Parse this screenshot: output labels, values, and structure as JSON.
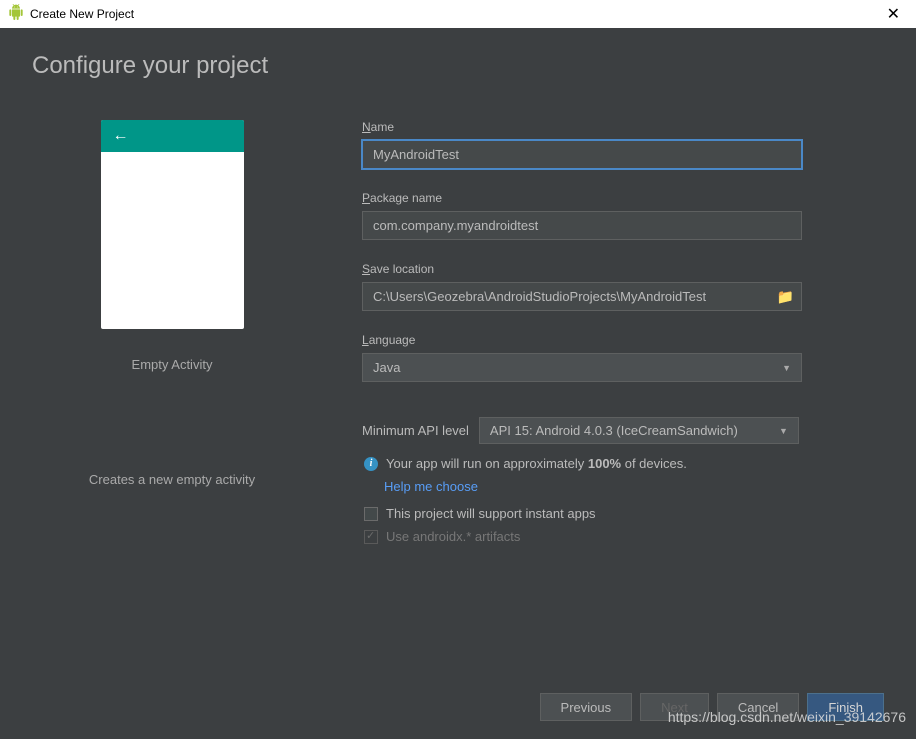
{
  "titlebar": {
    "title": "Create New Project"
  },
  "page": {
    "title": "Configure your project"
  },
  "preview": {
    "title": "Empty Activity",
    "description": "Creates a new empty activity"
  },
  "form": {
    "name_label": "Name",
    "name_value": "MyAndroidTest",
    "package_label": "Package name",
    "package_value": "com.company.myandroidtest",
    "save_label": "Save location",
    "save_value": "C:\\Users\\Geozebra\\AndroidStudioProjects\\MyAndroidTest",
    "language_label": "Language",
    "language_value": "Java",
    "api_label": "Minimum API level",
    "api_value": "API 15: Android 4.0.3 (IceCreamSandwich)",
    "info_text_pre": "Your app will run on approximately ",
    "info_text_pct": "100%",
    "info_text_post": " of devices.",
    "help_link": "Help me choose",
    "instant_apps_label": "This project will support instant apps",
    "androidx_label": "Use androidx.* artifacts"
  },
  "buttons": {
    "previous": "Previous",
    "next": "Next",
    "cancel": "Cancel",
    "finish": "Finish"
  },
  "watermark": "https://blog.csdn.net/weixin_39142676"
}
